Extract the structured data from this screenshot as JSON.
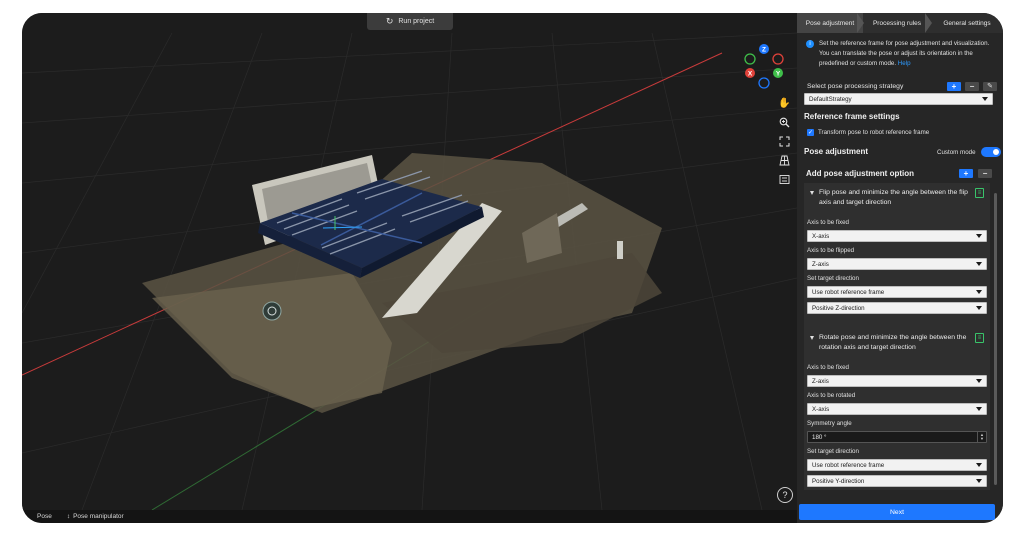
{
  "viewport": {
    "run_label": "Run project",
    "axes": {
      "z": "Z",
      "x": "X",
      "y": "Y"
    },
    "tools": [
      "hand-icon",
      "zoom-icon",
      "fit-view-icon",
      "perspective-icon",
      "display-settings-icon"
    ],
    "help": "?"
  },
  "statusbar": {
    "item1": "Pose",
    "item2": "Pose manipulator"
  },
  "panel": {
    "tabs": [
      "Pose adjustment",
      "Processing rules",
      "General settings"
    ],
    "info_text": "Set the reference frame for pose adjustment and visualization. You can translate the pose or adjust its orientation in the predefined or custom mode.",
    "info_link": "Help",
    "strategy_label": "Select pose processing strategy",
    "strategy_value": "DefaultStrategy",
    "ref_frame_title": "Reference frame settings",
    "transform_label": "Transform pose to robot reference frame",
    "pose_adjustment_title": "Pose adjustment",
    "custom_mode_label": "Custom mode",
    "add_option_title": "Add pose adjustment option",
    "flip": {
      "title": "Flip pose and minimize the angle between the flip axis and target direction",
      "fixed_label": "Axis to be fixed",
      "fixed_value": "X-axis",
      "flipped_label": "Axis to be flipped",
      "flipped_value": "Z-axis",
      "target_label": "Set target direction",
      "target_value": "Use robot reference frame",
      "direction_value": "Positive Z-direction"
    },
    "rotate": {
      "title": "Rotate pose and minimize the angle between the rotation axis and target direction",
      "fixed_label": "Axis to be fixed",
      "fixed_value": "Z-axis",
      "rotated_label": "Axis to be rotated",
      "rotated_value": "X-axis",
      "symmetry_label": "Symmetry angle",
      "symmetry_value": "180 °",
      "target_label": "Set target direction",
      "target_value": "Use robot reference frame",
      "direction_value": "Positive Y-direction"
    },
    "next_label": "Next"
  },
  "colors": {
    "accent": "#1e78ff",
    "link": "#2d9bff",
    "green": "#39c46a"
  }
}
